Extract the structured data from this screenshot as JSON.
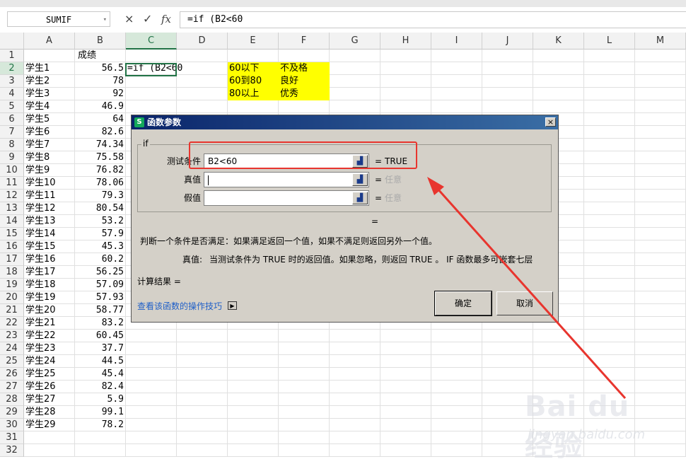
{
  "formula_bar": {
    "name_box": "SUMIF",
    "cancel_icon": "×",
    "confirm_icon": "✓",
    "fx_label": "fx",
    "formula": "=if (B2<60"
  },
  "columns": [
    "A",
    "B",
    "C",
    "D",
    "E",
    "F",
    "G",
    "H",
    "I",
    "J",
    "K",
    "L",
    "M"
  ],
  "rows": [
    "1",
    "2",
    "3",
    "4",
    "5",
    "6",
    "7",
    "8",
    "9",
    "10",
    "11",
    "12",
    "13",
    "14",
    "15",
    "16",
    "17",
    "18",
    "19",
    "20",
    "21",
    "22",
    "23",
    "24",
    "25",
    "26",
    "27",
    "28",
    "29",
    "30",
    "31",
    "32"
  ],
  "sheet": {
    "header_b1": "成绩",
    "students": [
      "学生1",
      "学生2",
      "学生3",
      "学生4",
      "学生5",
      "学生6",
      "学生7",
      "学生8",
      "学生9",
      "学生10",
      "学生11",
      "学生12",
      "学生13",
      "学生14",
      "学生15",
      "学生16",
      "学生17",
      "学生18",
      "学生19",
      "学生20",
      "学生21",
      "学生22",
      "学生23",
      "学生24",
      "学生25",
      "学生26",
      "学生27",
      "学生28",
      "学生29"
    ],
    "scores": [
      "56.5",
      "78",
      "92",
      "46.9",
      "64",
      "82.6",
      "74.34",
      "75.58",
      "76.82",
      "78.06",
      "79.3",
      "80.54",
      "53.2",
      "57.9",
      "45.3",
      "60.2",
      "56.25",
      "57.09",
      "57.93",
      "58.77",
      "83.2",
      "60.45",
      "37.7",
      "44.5",
      "45.4",
      "82.4",
      "5.9",
      "99.1",
      "78.2"
    ],
    "editing_cell_c2": "=if (B2<60",
    "grade_table": [
      {
        "range": "60以下",
        "grade": "不及格"
      },
      {
        "range": "60到80",
        "grade": "良好"
      },
      {
        "range": "80以上",
        "grade": "优秀"
      }
    ],
    "highlight_color": "#ffff00"
  },
  "dialog": {
    "logo": "S",
    "title": "函数参数",
    "close": "×",
    "group_label": "if",
    "args": [
      {
        "label": "测试条件",
        "value": "B2<60",
        "eq": "=",
        "result": "TRUE"
      },
      {
        "label": "真值",
        "value": "",
        "eq": "=",
        "result": "任意"
      },
      {
        "label": "假值",
        "value": "",
        "eq": "=",
        "result": "任意"
      }
    ],
    "overall_eq": "=",
    "description": "判断一个条件是否满足：如果满足返回一个值，如果不满足则返回另外一个值。",
    "param_name": "真值:",
    "param_desc": "当测试条件为 TRUE 时的返回值。如果忽略，则返回 TRUE 。 IF 函数最多可嵌套七层",
    "result_label": "计算结果 =",
    "help_link": "查看该函数的操作技巧",
    "ok": "确定",
    "cancel": "取消"
  },
  "annotation_color": "#e8352e",
  "watermark": {
    "brand": "Bai du 经验",
    "url": "jingyan.baidu.com"
  }
}
